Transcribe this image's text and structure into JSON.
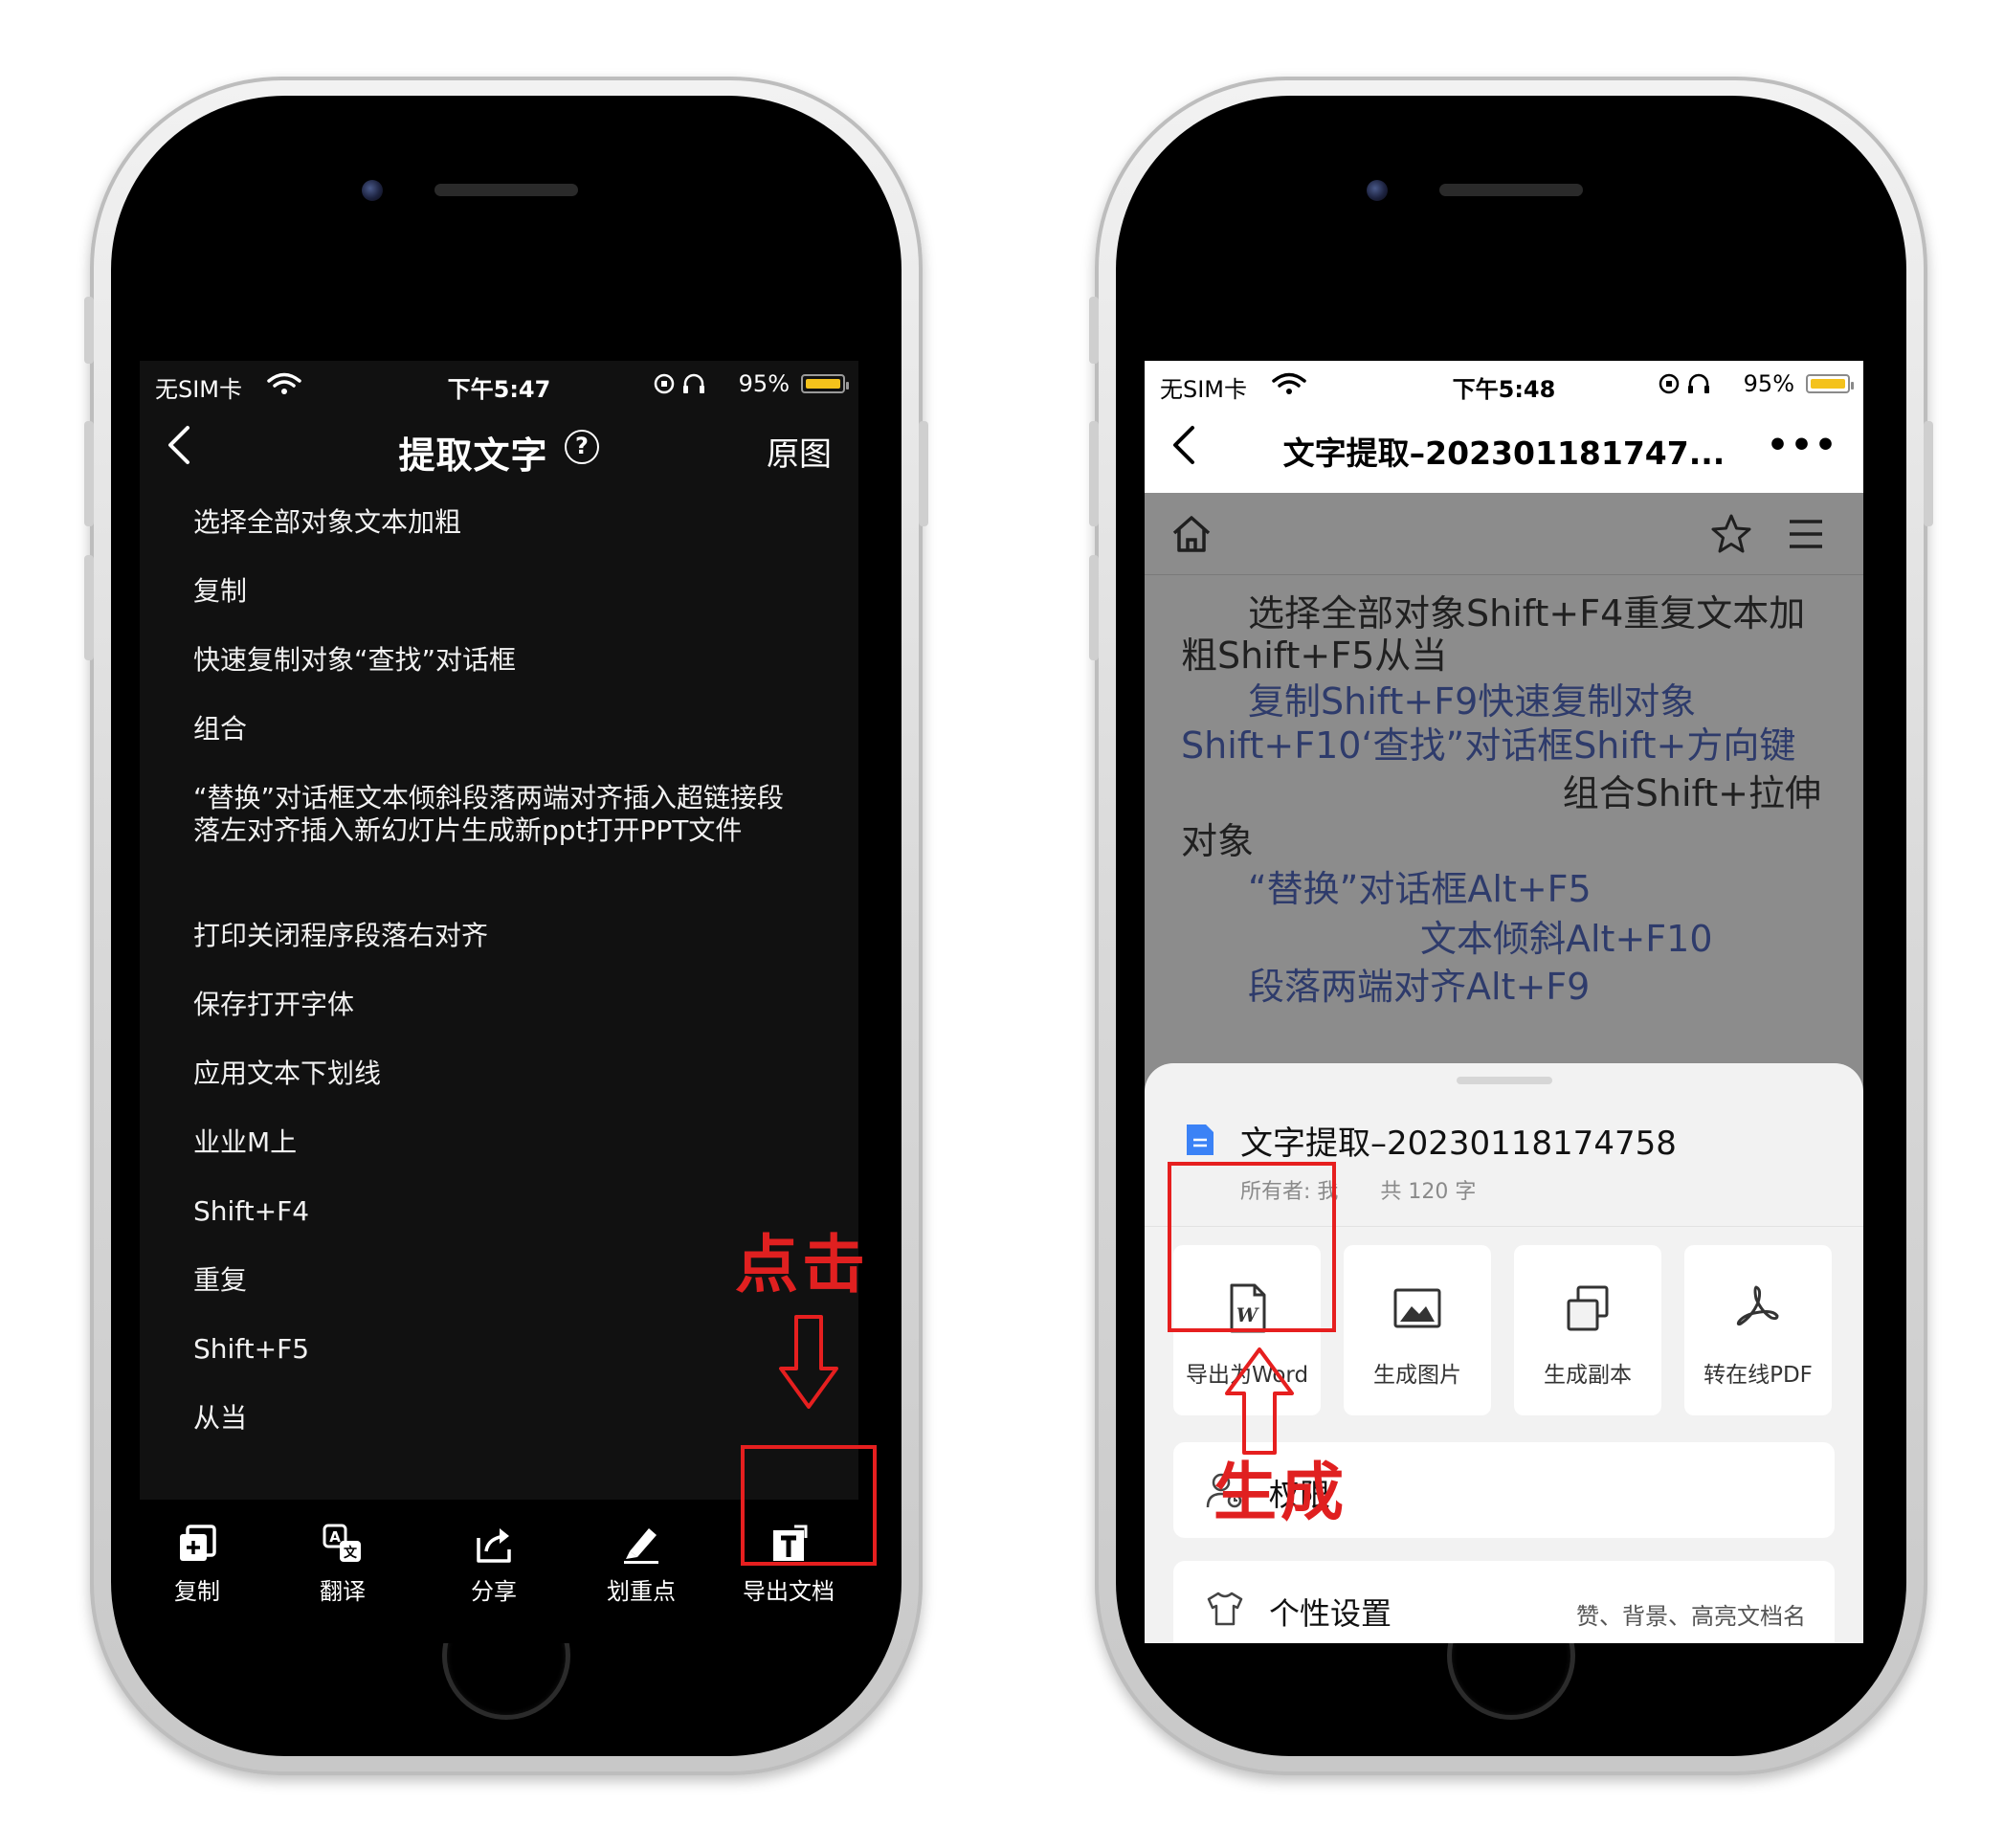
{
  "left_phone": {
    "status": {
      "carrier": "无SIM卡",
      "time": "下午5:47",
      "battery": "95%",
      "battery_level": 0.95
    },
    "nav": {
      "back_icon": "chevron-left-icon",
      "title": "提取文字",
      "help": "?",
      "right_action": "原图"
    },
    "lines": [
      "选择全部对象文本加粗",
      "复制",
      "快速复制对象“查找”对话框",
      "组合",
      "“替换”对话框文本倾斜段落两端对齐插入超链接段落左对齐插入新幻灯片生成新ppt打开PPT文件",
      "打印关闭程序段落右对齐",
      "保存打开字体",
      "应用文本下划线",
      "业业M上",
      "Shift+F4",
      "重复",
      "Shift+F5",
      "从当"
    ],
    "toolbar": [
      {
        "label": "复制",
        "icon": "copy-add-icon"
      },
      {
        "label": "翻译",
        "icon": "translate-icon"
      },
      {
        "label": "分享",
        "icon": "share-icon"
      },
      {
        "label": "划重点",
        "icon": "highlight-pen-icon"
      },
      {
        "label": "导出文档",
        "icon": "export-doc-icon"
      }
    ]
  },
  "right_phone": {
    "status": {
      "carrier": "无SIM卡",
      "time": "下午5:48",
      "battery": "95%",
      "battery_level": 0.95
    },
    "nav": {
      "back_icon": "chevron-left-icon",
      "title": "文字提取–202301181747...",
      "more": "•••"
    },
    "doc_toolbar": {
      "left": "home-icon",
      "right": [
        "star-icon",
        "menu-icon"
      ]
    },
    "doc_lines": [
      "选择全部对象Shift+F4重复文本加",
      "粗Shift+F5从当",
      "复制Shift+F9快速复制对象",
      "Shift+F10‘查找”对话框Shift+方向键",
      "组合Shift+拉伸",
      "对象",
      "“替换”对话框Alt+F5",
      "文本倾斜Alt+F10",
      "段落两端对齐Alt+F9"
    ],
    "sheet": {
      "doc_title": "文字提取–20230118174758",
      "owner": "所有者: 我",
      "word_count": "共 120 字",
      "actions": [
        {
          "label": "导出为Word",
          "icon": "word-file-icon"
        },
        {
          "label": "生成图片",
          "icon": "image-icon"
        },
        {
          "label": "生成副本",
          "icon": "duplicate-icon"
        },
        {
          "label": "转在线PDF",
          "icon": "pdf-icon"
        }
      ],
      "rows": [
        {
          "label": "权限",
          "icon": "user-permission-icon",
          "sub": ""
        },
        {
          "label": "个性设置",
          "icon": "shirt-icon",
          "sub": "赞、背景、高亮文档名"
        }
      ]
    }
  },
  "annotations": {
    "click_text": "点击",
    "generate_text": "生成",
    "color": "#e61f1f"
  }
}
